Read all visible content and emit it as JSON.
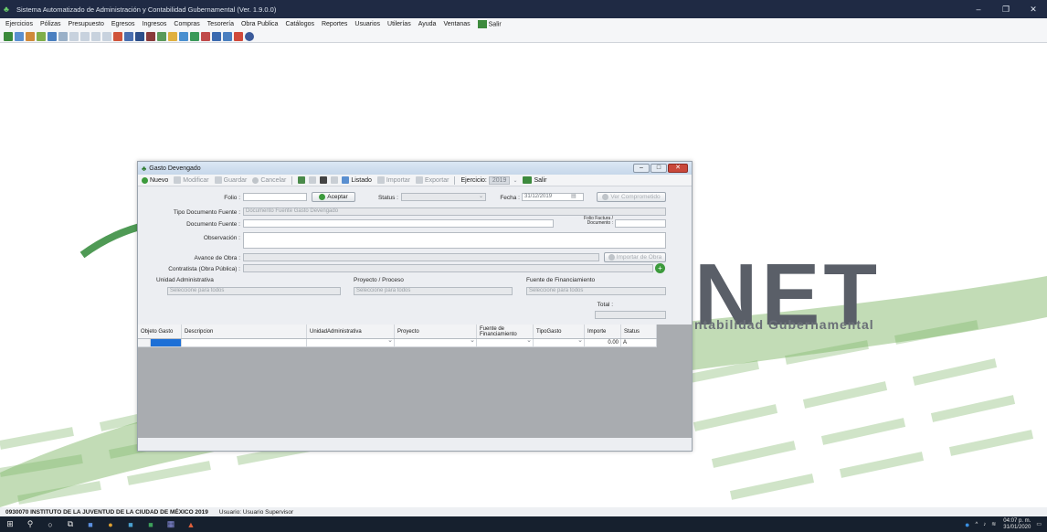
{
  "app": {
    "title": "Sistema Automatizado de Administración y Contabilidad Gubernamental  (Ver. 1.9.0.0)",
    "menu": [
      "Ejercicios",
      "Pólizas",
      "Presupuesto",
      "Egresos",
      "Ingresos",
      "Compras",
      "Tesorería",
      "Obra Publica",
      "Catálogos",
      "Reportes",
      "Usuarios",
      "Utilerías",
      "Ayuda",
      "Ventanas",
      "Salir"
    ],
    "logo_text": "NET",
    "logo_sub": "ntabilidad Gubernamental"
  },
  "dialog": {
    "title": "Gasto Devengado",
    "toolbar": {
      "nuevo": "Nuevo",
      "modificar": "Modificar",
      "guardar": "Guardar",
      "cancelar": "Cancelar",
      "listado": "Listado",
      "importar": "Importar",
      "exportar": "Exportar",
      "ejercicio_label": "Ejercicio:",
      "ejercicio_value": "2019",
      "salir": "Salir"
    },
    "form": {
      "folio_label": "Folio :",
      "aceptar": "Aceptar",
      "status_label": "Status :",
      "fecha_label": "Fecha :",
      "fecha_value": "31/12/2019",
      "ver_comprometido": "Ver Comprometido",
      "tipo_doc_label": "Tipo Documento Fuente :",
      "tipo_doc_value": "Documento Fuente Gasto Devengado",
      "doc_fuente_label": "Documento Fuente :",
      "folio_factura_label": "Folio Factura / Documento :",
      "observacion_label": "Observación :",
      "avance_label": "Avance de Obra :",
      "importar_de_obra": "Importar de Obra",
      "contratista_label": "Contratista (Obra Pública) :",
      "unidad_label": "Unidad Administrativa",
      "proyecto_label": "Proyecto / Proceso",
      "fuente_label": "Fuente de Financiamiento",
      "select_placeholder": "Seleccione para todos",
      "total_label": "Total :"
    },
    "grid": {
      "headers": [
        "Objeto Gasto",
        "Descripcion",
        "UnidadAdministrativa",
        "Proyecto",
        "Fuente de Financiamiento",
        "TipoGasto",
        "Importe",
        "Status"
      ],
      "row": {
        "importe": "0.00",
        "status": "A"
      }
    }
  },
  "statusbar": {
    "org": "0930070 INSTITUTO DE LA JUVENTUD DE LA CIUDAD DE MÉXICO 2019",
    "user": "Usuario: Usuario Supervisor"
  },
  "taskbar": {
    "time": "04:07 p. m.",
    "date": "31/01/2020"
  },
  "colors": {
    "accent_green": "#3c9a3c",
    "title_bar": "#1f2a44",
    "selected_cell": "#1c6fd6"
  }
}
